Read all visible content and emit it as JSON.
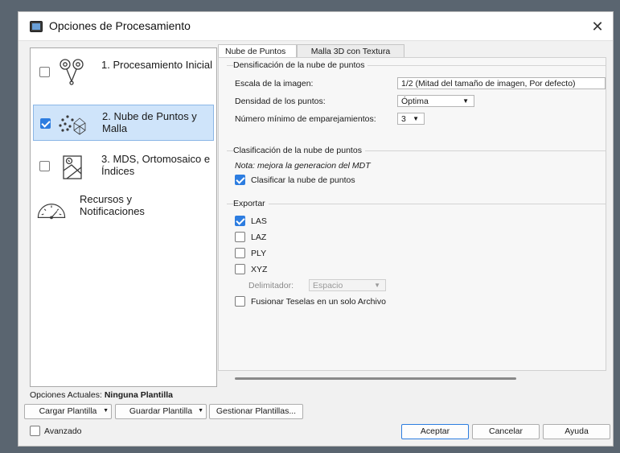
{
  "window": {
    "title": "Opciones de Procesamiento",
    "close_glyph": "✕"
  },
  "nav": [
    {
      "label": "1. Procesamiento Inicial",
      "checked": false,
      "icon": "processing-gears-icon"
    },
    {
      "label": "2. Nube de Puntos y Malla",
      "checked": true,
      "selected": true,
      "icon": "point-cloud-mesh-icon"
    },
    {
      "label": "3. MDS, Ortomosaico e Índices",
      "checked": false,
      "icon": "dsm-ortho-icon"
    },
    {
      "label": "Recursos y Notificaciones",
      "icon": "gauge-icon"
    }
  ],
  "tabs": [
    {
      "label": "Nube de Puntos",
      "active": true
    },
    {
      "label": "Malla 3D con Textura",
      "active": false
    }
  ],
  "densification": {
    "title": "Densificación de la nube de puntos",
    "scale_label": "Escala de la imagen:",
    "scale_value": "1/2 (Mitad del tamaño de imagen, Por defecto)",
    "density_label": "Densidad de los puntos:",
    "density_value": "Óptima",
    "min_matches_label": "Número mínimo de emparejamientos:",
    "min_matches_value": "3"
  },
  "classification": {
    "title": "Clasificación de la nube de puntos",
    "note": "Nota: mejora la generacion del MDT",
    "classify_label": "Clasificar la nube de puntos",
    "classify_checked": true
  },
  "export": {
    "title": "Exportar",
    "formats": [
      {
        "label": "LAS",
        "checked": true
      },
      {
        "label": "LAZ",
        "checked": false
      },
      {
        "label": "PLY",
        "checked": false
      },
      {
        "label": "XYZ",
        "checked": false
      }
    ],
    "delimiter_label": "Delimitador:",
    "delimiter_value": "Espacio",
    "merge_label": "Fusionar Teselas en un solo Archivo",
    "merge_checked": false
  },
  "footer": {
    "current_label": "Opciones Actuales:",
    "current_value": "Ninguna Plantilla",
    "load_template": "Cargar Plantilla",
    "save_template": "Guardar Plantilla",
    "manage_templates": "Gestionar Plantillas...",
    "advanced_label": "Avanzado",
    "advanced_checked": false,
    "accept": "Aceptar",
    "cancel": "Cancelar",
    "help": "Ayuda"
  },
  "colors": {
    "accent": "#2d7de0",
    "selection": "#cfe4fa",
    "dialog_bg": "#f1f1f1"
  }
}
